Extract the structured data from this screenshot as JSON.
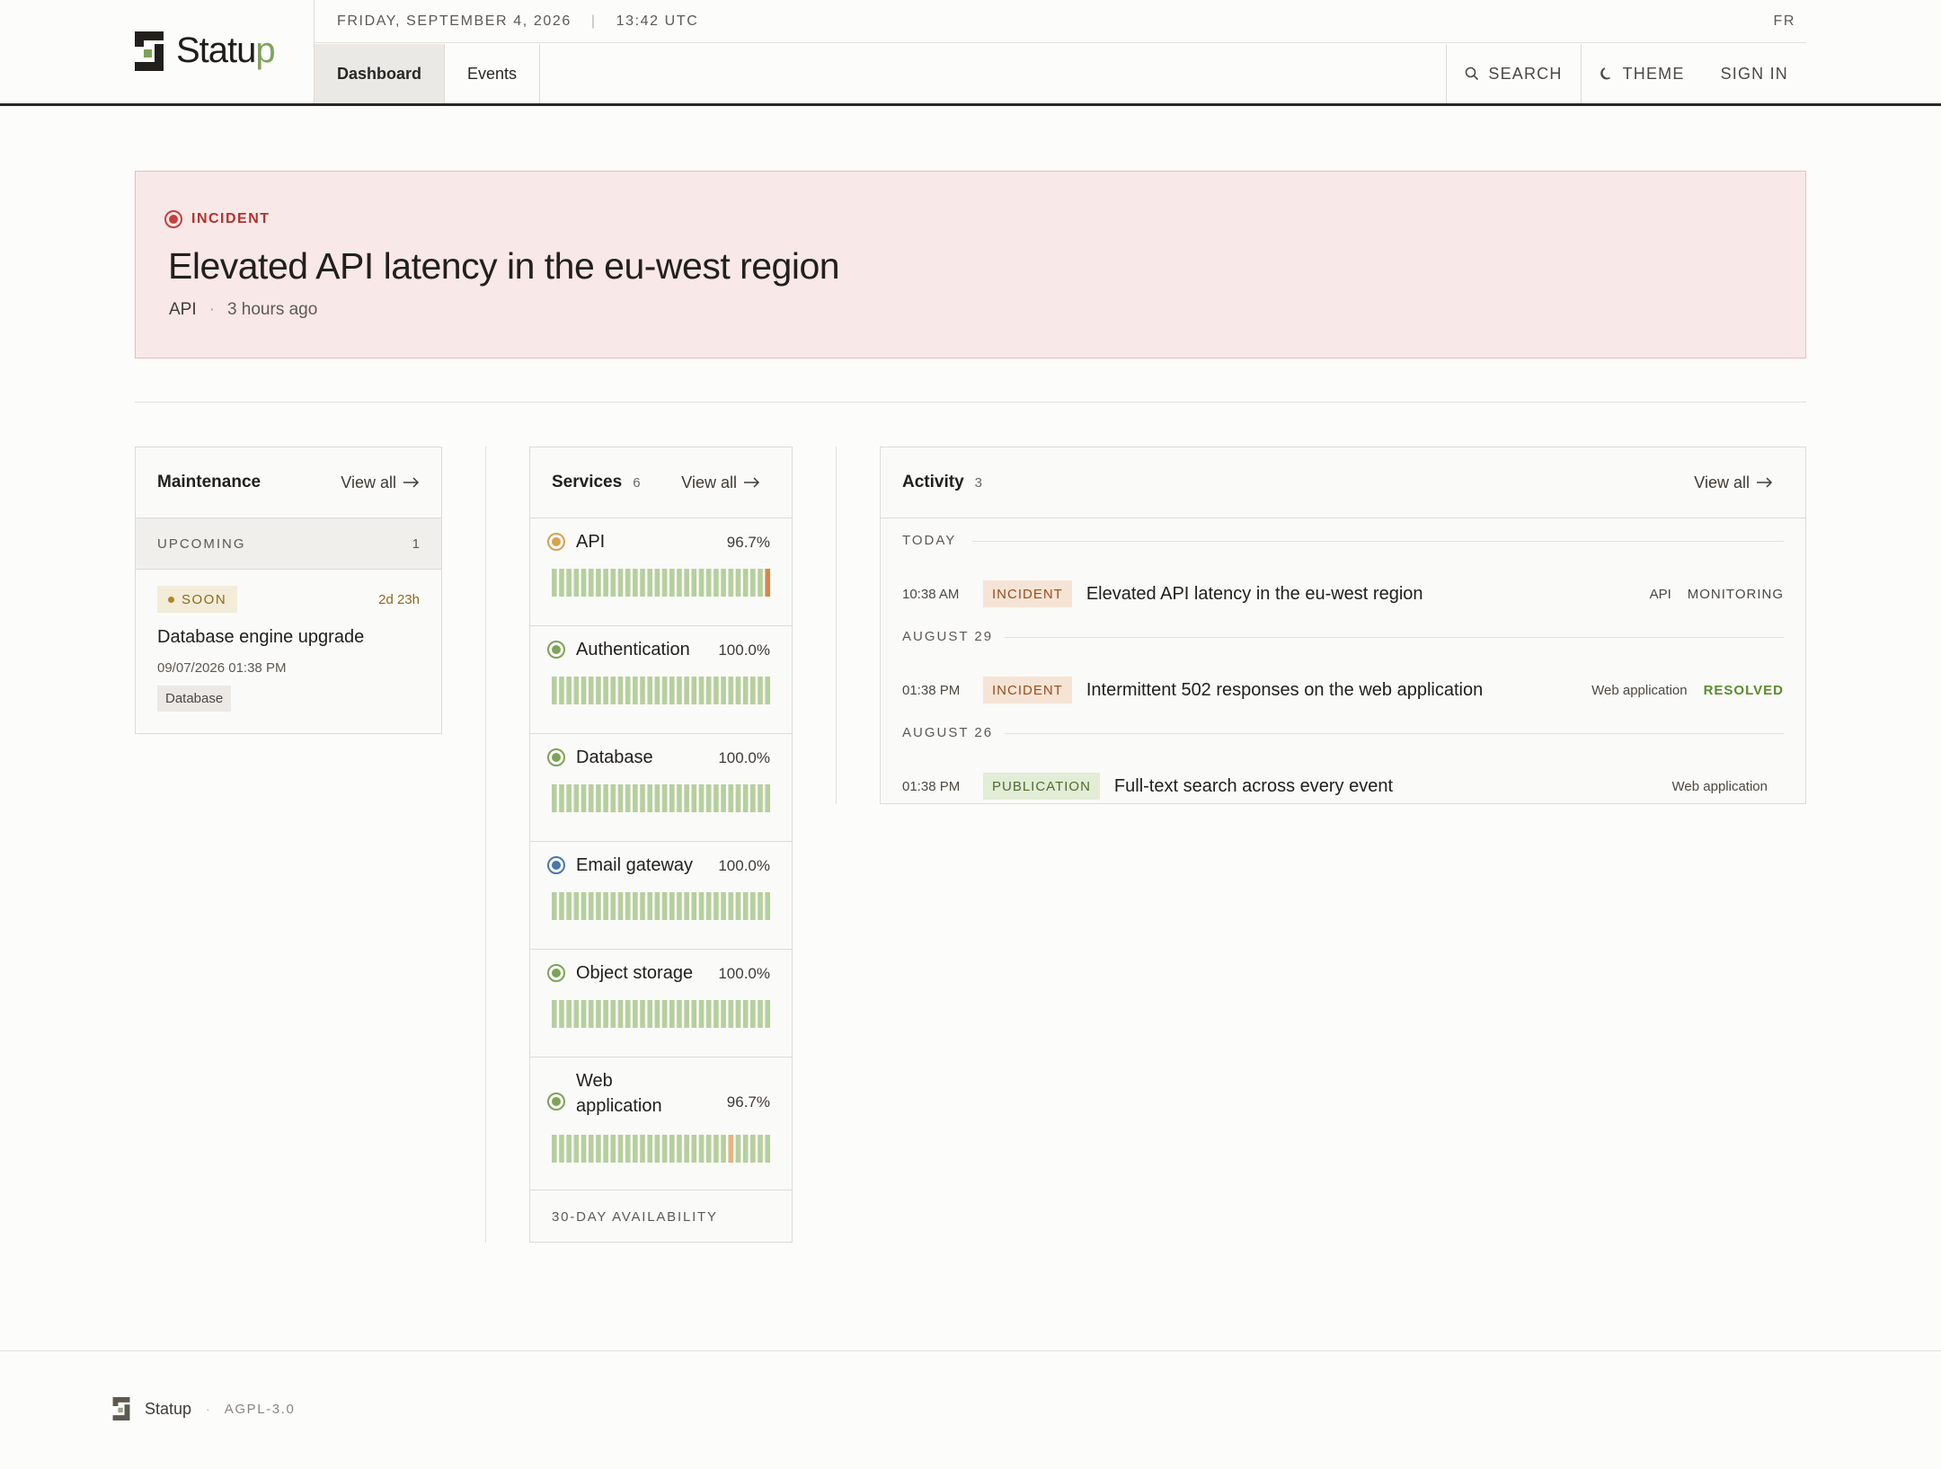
{
  "header": {
    "brand_main": "Statu",
    "brand_accent": "p",
    "date": "FRIDAY, SEPTEMBER 4, 2026",
    "time": "13:42 UTC",
    "lang": "FR",
    "tabs": [
      {
        "label": "Dashboard",
        "active": true
      },
      {
        "label": "Events",
        "active": false
      }
    ],
    "search_label": "SEARCH",
    "theme_label": "THEME",
    "signin_label": "SIGN IN"
  },
  "incident_banner": {
    "label": "INCIDENT",
    "title": "Elevated API latency in the eu-west region",
    "service": "API",
    "time_ago": "3 hours ago"
  },
  "maintenance": {
    "title": "Maintenance",
    "view_all": "View all",
    "upcoming_label": "UPCOMING",
    "upcoming_count": "1",
    "item": {
      "badge": "SOON",
      "countdown": "2d 23h",
      "title": "Database engine upgrade",
      "date": "09/07/2026 01:38 PM",
      "tag": "Database"
    }
  },
  "services": {
    "title": "Services",
    "count": "6",
    "view_all": "View all",
    "footer": "30-DAY AVAILABILITY",
    "items": [
      {
        "name": "API",
        "pct": "96.7%",
        "status": "degraded",
        "bars": [
          0,
          0,
          0,
          0,
          0,
          0,
          0,
          0,
          0,
          0,
          0,
          0,
          0,
          0,
          0,
          0,
          0,
          0,
          0,
          0,
          0,
          0,
          0,
          0,
          0,
          0,
          0,
          0,
          0,
          2
        ]
      },
      {
        "name": "Authentication",
        "pct": "100.0%",
        "status": "operational",
        "bars": [
          0,
          0,
          0,
          0,
          0,
          0,
          0,
          0,
          0,
          0,
          0,
          0,
          0,
          0,
          0,
          0,
          0,
          0,
          0,
          0,
          0,
          0,
          0,
          0,
          0,
          0,
          0,
          0,
          0,
          0
        ]
      },
      {
        "name": "Database",
        "pct": "100.0%",
        "status": "operational",
        "bars": [
          0,
          0,
          0,
          0,
          0,
          0,
          0,
          0,
          0,
          0,
          0,
          0,
          0,
          0,
          0,
          0,
          0,
          0,
          0,
          0,
          0,
          0,
          0,
          0,
          0,
          0,
          0,
          0,
          0,
          0
        ]
      },
      {
        "name": "Email gateway",
        "pct": "100.0%",
        "status": "maintenance",
        "bars": [
          0,
          0,
          0,
          0,
          0,
          0,
          0,
          0,
          0,
          0,
          0,
          0,
          0,
          0,
          0,
          0,
          0,
          0,
          0,
          0,
          0,
          0,
          0,
          0,
          0,
          0,
          0,
          0,
          0,
          0
        ]
      },
      {
        "name": "Object storage",
        "pct": "100.0%",
        "status": "operational",
        "bars": [
          0,
          0,
          0,
          0,
          0,
          0,
          0,
          0,
          0,
          0,
          0,
          0,
          0,
          0,
          0,
          0,
          0,
          0,
          0,
          0,
          0,
          0,
          0,
          0,
          0,
          0,
          0,
          0,
          0,
          0
        ]
      },
      {
        "name": "Web application",
        "name_lines": [
          "Web",
          "application"
        ],
        "pct": "96.7%",
        "status": "operational",
        "bars": [
          0,
          0,
          0,
          0,
          0,
          0,
          0,
          0,
          0,
          0,
          0,
          0,
          0,
          0,
          0,
          0,
          0,
          0,
          0,
          0,
          0,
          0,
          0,
          0,
          1,
          0,
          0,
          0,
          0,
          0
        ]
      }
    ]
  },
  "activity": {
    "title": "Activity",
    "count": "3",
    "view_all": "View all",
    "days": [
      {
        "label": "TODAY",
        "entries": [
          {
            "time": "10:38 AM",
            "type": "INCIDENT",
            "title": "Elevated API latency in the eu-west region",
            "service": "API",
            "status": "MONITORING"
          }
        ]
      },
      {
        "label": "AUGUST 29",
        "entries": [
          {
            "time": "01:38 PM",
            "type": "INCIDENT",
            "title": "Intermittent 502 responses on the web application",
            "service": "Web application",
            "status": "RESOLVED"
          }
        ]
      },
      {
        "label": "AUGUST 26",
        "entries": [
          {
            "time": "01:38 PM",
            "type": "PUBLICATION",
            "title": "Full-text search across every event",
            "service": "Web application",
            "status": ""
          }
        ]
      }
    ]
  },
  "footer": {
    "brand": "Statup",
    "license": "AGPL-3.0"
  },
  "colors": {
    "accent": "#7ea35a",
    "incident": "#c7403b",
    "operational": "#7ea35a",
    "degraded": "#d7a24e",
    "maintenance": "#4a78a8",
    "bar_ok": "#b6cf9e",
    "bar_partial": "#e6b27e",
    "bar_outage": "#d9874a"
  }
}
